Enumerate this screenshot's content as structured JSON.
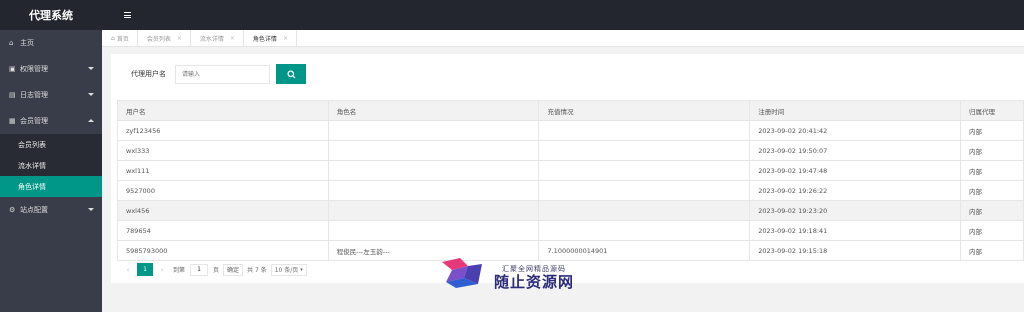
{
  "app": {
    "title": "代理系统"
  },
  "sidebar": {
    "items": [
      {
        "label": "主页",
        "icon": "home-icon"
      },
      {
        "label": "权限管理",
        "icon": "permission-icon"
      },
      {
        "label": "日志管理",
        "icon": "log-icon"
      },
      {
        "label": "会员管理",
        "icon": "member-icon",
        "expanded": true,
        "children": [
          {
            "label": "会员列表"
          },
          {
            "label": "流水详情"
          },
          {
            "label": "角色详情",
            "active": true
          }
        ]
      },
      {
        "label": "站点配置",
        "icon": "settings-icon"
      }
    ]
  },
  "tabs": [
    {
      "label": "首页"
    },
    {
      "label": "会员列表"
    },
    {
      "label": "流水详情"
    },
    {
      "label": "角色详情",
      "current": true
    }
  ],
  "search": {
    "label": "代理用户名",
    "placeholder": "请输入",
    "button_icon": "search-icon"
  },
  "table": {
    "columns": [
      "用户名",
      "角色名",
      "充值情况",
      "注册时间",
      "归属代理"
    ],
    "rows": [
      [
        "zyf123456",
        "",
        "",
        "2023-09-02 20:41:42",
        "内部"
      ],
      [
        "wxl333",
        "",
        "",
        "2023-09-02 19:50:07",
        "内部"
      ],
      [
        "wxl111",
        "",
        "",
        "2023-09-02 19:47:48",
        "内部"
      ],
      [
        "9527000",
        "",
        "",
        "2023-09-02 19:26:22",
        "内部"
      ],
      [
        "wxl456",
        "",
        "",
        "2023-09-02 19:23:20",
        "内部"
      ],
      [
        "789654",
        "",
        "",
        "2023-09-02 19:18:41",
        "内部"
      ],
      [
        "5985793000",
        "程俊民---左玉韵---",
        "7.1000000014901",
        "2023-09-02 19:15:18",
        "内部"
      ]
    ]
  },
  "pager": {
    "current_page": "1",
    "goto_label": "到第",
    "goto_value": "1",
    "page_unit": "页",
    "confirm": "确定",
    "total": "共 7 条",
    "page_size": "10 条/页"
  },
  "watermark": {
    "sub": "汇聚全网精品源码",
    "main": "随止资源网"
  },
  "colors": {
    "accent": "#009688",
    "sidebar_bg": "#393d49",
    "topbar_bg": "#23262e"
  }
}
